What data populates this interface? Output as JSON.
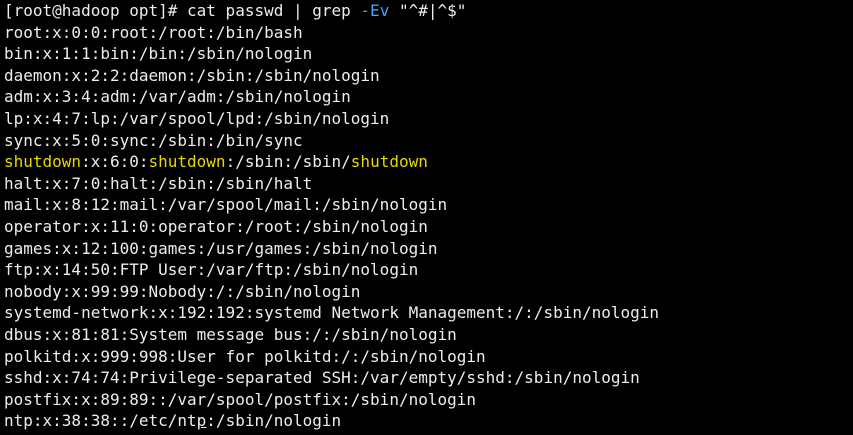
{
  "terminal": {
    "prompt": "[root@hadoop opt]# cat passwd | grep ",
    "grep_option": "-Ev",
    "grep_pattern": " \"^#|^$\"",
    "highlight_color": "#e8d800",
    "option_color": "#3aa6ff",
    "text_color": "#ededed",
    "background_color": "#000000",
    "lines": [
      "root:x:0:0:root:/root:/bin/bash",
      "bin:x:1:1:bin:/bin:/sbin/nologin",
      "daemon:x:2:2:daemon:/sbin:/sbin/nologin",
      "adm:x:3:4:adm:/var/adm:/sbin/nologin",
      "lp:x:4:7:lp:/var/spool/lpd:/sbin/nologin",
      "sync:x:5:0:sync:/sbin:/bin/sync",
      "halt:x:7:0:halt:/sbin:/sbin/halt",
      "mail:x:8:12:mail:/var/spool/mail:/sbin/nologin",
      "operator:x:11:0:operator:/root:/sbin/nologin",
      "games:x:12:100:games:/usr/games:/sbin/nologin",
      "ftp:x:14:50:FTP User:/var/ftp:/sbin/nologin",
      "nobody:x:99:99:Nobody:/:/sbin/nologin",
      "systemd-network:x:192:192:systemd Network Management:/:/sbin/nologin",
      "dbus:x:81:81:System message bus:/:/sbin/nologin",
      "polkitd:x:999:998:User for polkitd:/:/sbin/nologin",
      "sshd:x:74:74:Privilege-separated SSH:/var/empty/sshd:/sbin/nologin",
      "postfix:x:89:89::/var/spool/postfix:/sbin/nologin"
    ],
    "shutdown_line": {
      "word1": "shutdown",
      "part1": ":x:6:0:",
      "word2": "shutdown",
      "part2": ":/sbin:/sbin/",
      "word3": "shutdown"
    },
    "ntp_line": {
      "before_cursor": "ntp:x:38:38::/etc/nt",
      "cursor_char": "p",
      "after_cursor": ":/sbin/nologin"
    }
  }
}
